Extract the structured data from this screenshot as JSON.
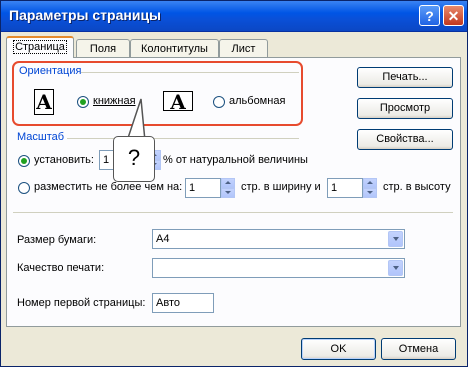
{
  "window": {
    "title": "Параметры страницы"
  },
  "tabs": [
    "Страница",
    "Поля",
    "Колонтитулы",
    "Лист"
  ],
  "orientation": {
    "label": "Ориентация",
    "portrait_label": "книжная",
    "landscape_label": "альбомная",
    "icon_glyph": "A"
  },
  "scale": {
    "label": "Масштаб",
    "set_label": "установить:",
    "set_value": "1",
    "set_suffix": "% от натуральной величины",
    "fit_label": "разместить не более чем на:",
    "fit_wide_value": "1",
    "fit_wide_suffix": "стр. в ширину и",
    "fit_tall_value": "1",
    "fit_tall_suffix": "стр. в высоту"
  },
  "paper": {
    "label": "Размер бумаги:",
    "value": "A4"
  },
  "quality": {
    "label": "Качество печати:",
    "value": ""
  },
  "first_page": {
    "label": "Номер первой страницы:",
    "value": "Авто"
  },
  "side_buttons": {
    "print": "Печать...",
    "preview": "Просмотр",
    "properties": "Свойства..."
  },
  "footer": {
    "ok": "OK",
    "cancel": "Отмена"
  },
  "callout": {
    "text": "?"
  },
  "colors": {
    "highlight": "#e74b2e",
    "title_bar": "#0055e5",
    "group_label": "#0046d5"
  }
}
